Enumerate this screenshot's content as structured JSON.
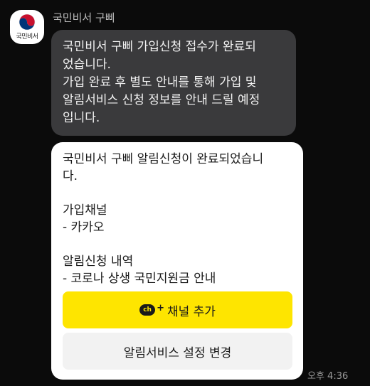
{
  "sender": {
    "name": "국민비서 구삐",
    "avatar_label": "국민비서"
  },
  "message1": {
    "text": "국민비서 구삐 가입신청 접수가 완료되\n었습니다.\n가입 완료 후 별도 안내를 통해 가입 및\n알림서비스 신청 정보를 안내 드릴 예정\n입니다."
  },
  "card": {
    "text": "국민비서 구삐 알림신청이 완료되었습니\n다.\n\n가입채널\n- 카카오\n\n알림신청 내역\n- 코로나 상생 국민지원금 안내",
    "channel_icon_text": "ch",
    "channel_plus": "+",
    "add_channel_label": "채널 추가",
    "change_settings_label": "알림서비스 설정 변경"
  },
  "timestamp": "오후 4:36",
  "colors": {
    "background": "#0b0b0b",
    "dark_bubble": "#3a3a3c",
    "card": "#ffffff",
    "accent_yellow": "#fee500",
    "gray_button": "#f2f2f2"
  },
  "icons": {
    "avatar": "taegeuk-emblem-icon",
    "channel": "kakao-channel-icon"
  }
}
